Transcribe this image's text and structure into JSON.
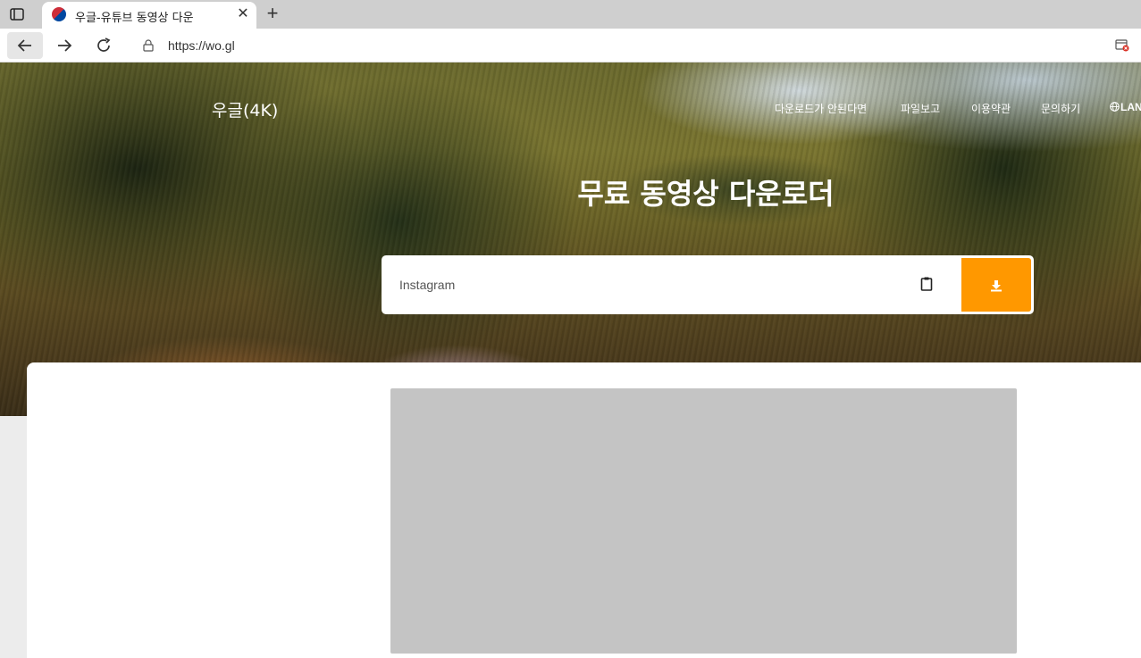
{
  "browser": {
    "tab_title": "우글-유튜브 동영상 다운",
    "tab_close_glyph": "✕",
    "new_tab_glyph": "+",
    "url": "https://wo.gl",
    "icons": {
      "tab_actions": "tab-actions-icon",
      "back": "back-arrow-icon",
      "forward": "forward-arrow-icon",
      "reload": "reload-icon",
      "lock": "lock-icon",
      "site_info": "site-permissions-icon"
    }
  },
  "header": {
    "brand": "우글(4K)",
    "nav_items": [
      {
        "label": "다운로드가 안된다면"
      },
      {
        "label": "파일보고"
      },
      {
        "label": "이용약관"
      },
      {
        "label": "문의하기"
      }
    ],
    "lang_label": "LAN"
  },
  "hero": {
    "title": "무료 동영상 다운로더"
  },
  "search": {
    "placeholder": "Instagram",
    "value": "",
    "button_color": "#ff9800"
  },
  "colors": {
    "accent": "#ff9800",
    "ad_placeholder": "#c4c4c4"
  }
}
